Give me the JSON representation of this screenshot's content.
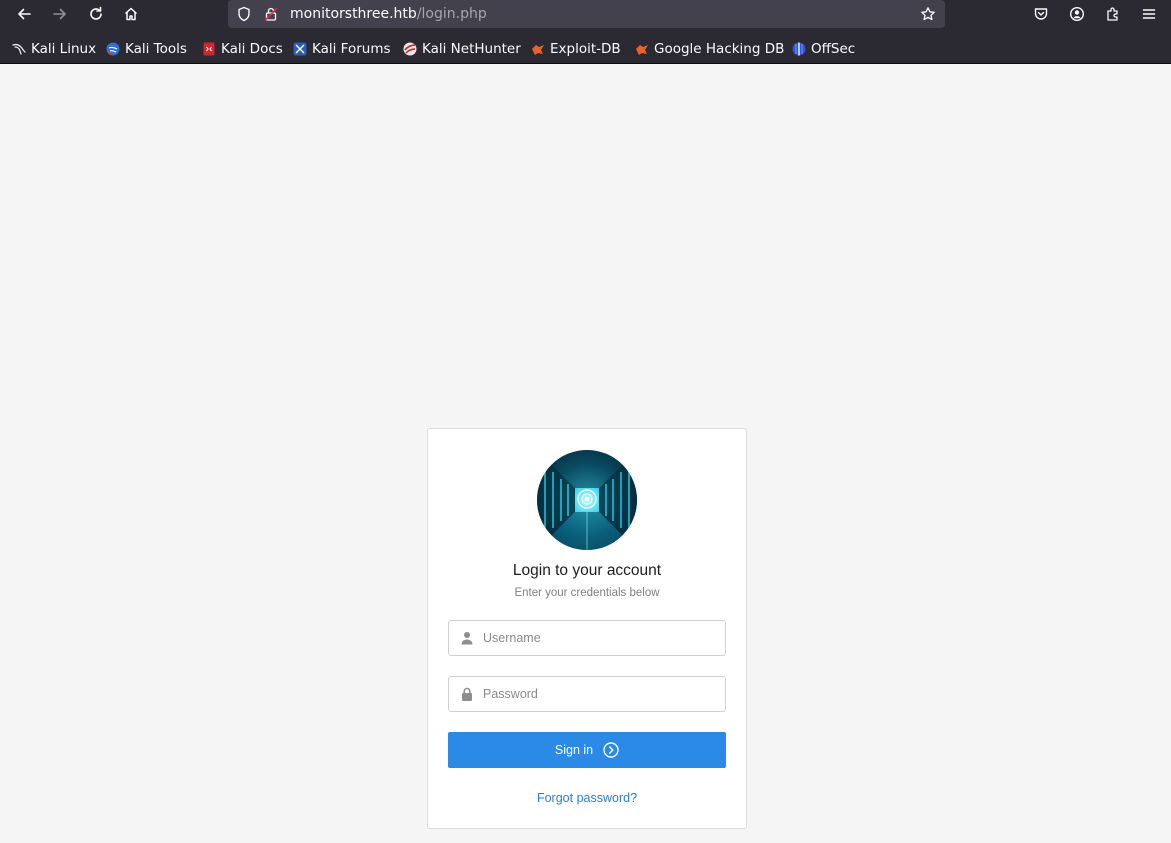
{
  "browser": {
    "url_host": "monitorsthree.htb",
    "url_path": "/login.php",
    "toolbar_icons": [
      "back-arrow-icon",
      "forward-arrow-icon",
      "reload-icon",
      "home-icon",
      "shield-icon",
      "lock-insecure-icon",
      "star-icon",
      "pocket-icon",
      "account-icon",
      "extensions-icon",
      "menu-icon"
    ]
  },
  "bookmarks": [
    {
      "label": "Kali Linux",
      "icon": "kali-dragon-icon"
    },
    {
      "label": "Kali Tools",
      "icon": "kali-tools-icon"
    },
    {
      "label": "Kali Docs",
      "icon": "kali-docs-icon"
    },
    {
      "label": "Kali Forums",
      "icon": "kali-forums-icon"
    },
    {
      "label": "Kali NetHunter",
      "icon": "nethunter-icon"
    },
    {
      "label": "Exploit-DB",
      "icon": "exploit-db-icon"
    },
    {
      "label": "Google Hacking DB",
      "icon": "ghdb-icon"
    },
    {
      "label": "OffSec",
      "icon": "offsec-icon"
    }
  ],
  "login": {
    "title": "Login to your account",
    "subtitle": "Enter your credentials below",
    "username_placeholder": "Username",
    "password_placeholder": "Password",
    "signin_label": "Sign in",
    "forgot_label": "Forgot password?"
  },
  "colors": {
    "chrome_bg": "#2b2a33",
    "urlbar_bg": "#42414d",
    "page_bg": "#f5f5f5",
    "primary_button": "#2b8ae6",
    "link": "#2b7fd4"
  }
}
